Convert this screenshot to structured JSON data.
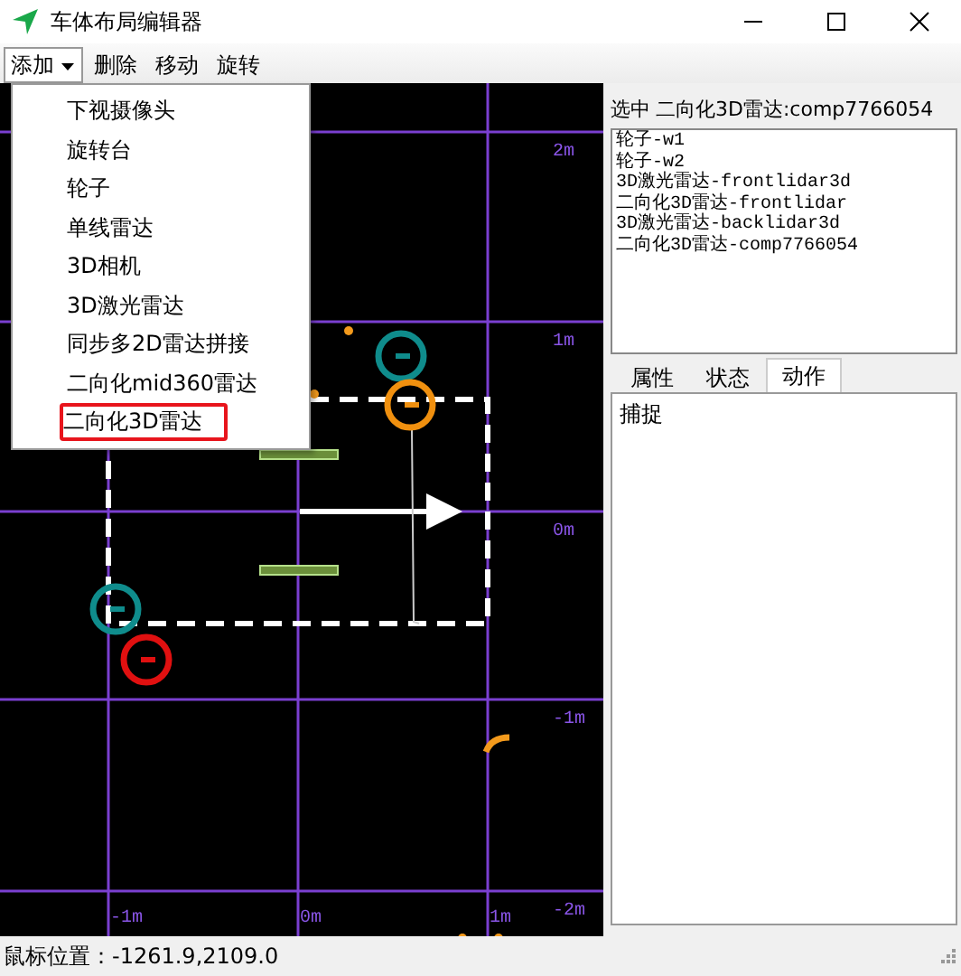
{
  "window": {
    "title": "车体布局编辑器"
  },
  "toolbar": [
    {
      "label": "添加",
      "kind": "dropdown",
      "expanded": true
    },
    {
      "label": "删除",
      "kind": "button",
      "expanded": false
    },
    {
      "label": "移动",
      "kind": "button",
      "expanded": false
    },
    {
      "label": "旋转",
      "kind": "button",
      "expanded": false
    }
  ],
  "add_menu": {
    "items": [
      {
        "label": "下视摄像头",
        "selected": false
      },
      {
        "label": "旋转台",
        "selected": false
      },
      {
        "label": "轮子",
        "selected": false
      },
      {
        "label": "单线雷达",
        "selected": false
      },
      {
        "label": "3D相机",
        "selected": false
      },
      {
        "label": "3D激光雷达",
        "selected": false
      },
      {
        "label": "同步多2D雷达拼接",
        "selected": false
      },
      {
        "label": "二向化mid360雷达",
        "selected": false
      },
      {
        "label": "二向化3D雷达",
        "selected": true
      }
    ]
  },
  "canvas": {
    "y_axis_labels": [
      "2m",
      "1m",
      "0m",
      "-1m",
      "-2m"
    ],
    "x_axis_labels": [
      "-1m",
      "0m",
      "1m"
    ],
    "sensors": [
      {
        "color": "#0f8c8c"
      },
      {
        "color": "#f0900f"
      },
      {
        "color": "#0f8c8c"
      },
      {
        "color": "#e01010"
      }
    ]
  },
  "selection": {
    "label": "选中",
    "value": "二向化3D雷达:comp7766054"
  },
  "component_list": [
    "轮子-w1",
    "轮子-w2",
    "3D激光雷达-frontlidar3d",
    "二向化3D雷达-frontlidar",
    "3D激光雷达-backlidar3d",
    "二向化3D雷达-comp7766054"
  ],
  "tabs": [
    {
      "label": "属性",
      "selected": false
    },
    {
      "label": "状态",
      "selected": false
    },
    {
      "label": "动作",
      "selected": true
    }
  ],
  "tab_content": [
    "捕捉"
  ],
  "status_bar": {
    "text": "鼠标位置：-1261.9,2109.0"
  }
}
